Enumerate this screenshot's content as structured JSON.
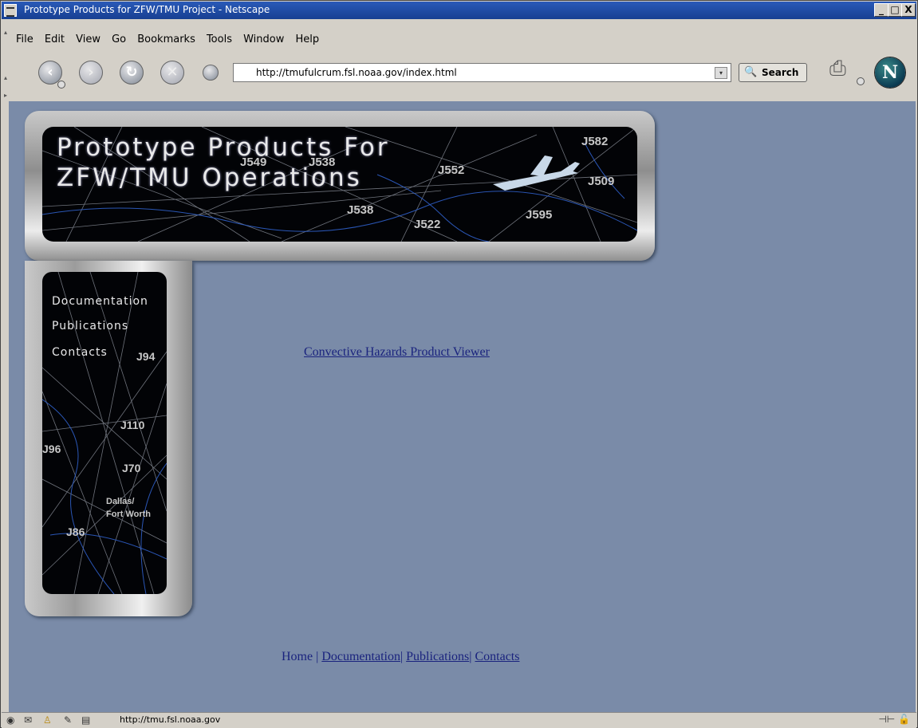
{
  "window": {
    "title": "Prototype Products for ZFW/TMU Project - Netscape",
    "controls": {
      "minimize": "_",
      "maximize": "□",
      "close": "X"
    }
  },
  "menu": {
    "items": [
      {
        "label": "File"
      },
      {
        "label": "Edit"
      },
      {
        "label": "View"
      },
      {
        "label": "Go"
      },
      {
        "label": "Bookmarks"
      },
      {
        "label": "Tools"
      },
      {
        "label": "Window"
      },
      {
        "label": "Help"
      }
    ]
  },
  "navbar": {
    "back_glyph": "‹",
    "forward_glyph": "›",
    "reload_glyph": "↻",
    "stop_glyph": "✕",
    "url": "http://tmufulcrum.fsl.noaa.gov/index.html",
    "search_label": "Search",
    "logo_letter": "N"
  },
  "banner": {
    "title_line1": "Prototype Products For",
    "title_line2": "ZFW/TMU Operations",
    "routes": [
      "J582",
      "J549",
      "J538",
      "J552",
      "J509",
      "J538",
      "J522",
      "J595"
    ]
  },
  "sidebar": {
    "links": [
      {
        "label": "Documentation"
      },
      {
        "label": "Publications"
      },
      {
        "label": "Contacts"
      }
    ],
    "map_labels": [
      "J94",
      "J110",
      "J96",
      "J70",
      "Dallas/",
      "Fort Worth",
      "J86"
    ]
  },
  "main": {
    "link": "Convective Hazards Product Viewer"
  },
  "footer": {
    "home": "Home",
    "sep": "|",
    "documentation": "Documentation",
    "publications": "Publications",
    "contacts": "Contacts"
  },
  "status": {
    "url": "http://tmu.fsl.noaa.gov"
  },
  "colors": {
    "page_background": "#7a8ba8",
    "link": "#1a237e",
    "title_bar": "#2a5ab8"
  },
  "icons": [
    "window-menu-icon",
    "back-icon",
    "forward-icon",
    "reload-icon",
    "stop-icon",
    "url-history-icon",
    "search-icon",
    "print-icon",
    "netscape-logo-icon",
    "mail-icon",
    "chat-icon",
    "composer-icon",
    "address-book-icon",
    "online-icon",
    "lock-icon"
  ]
}
